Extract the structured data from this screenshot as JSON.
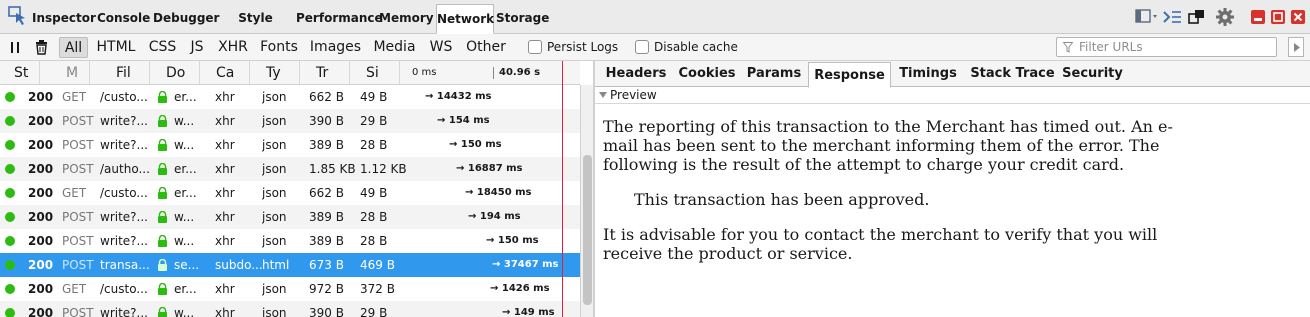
{
  "toolbox": {
    "tabs": [
      {
        "label": "Inspector"
      },
      {
        "label": "Console"
      },
      {
        "label": "Debugger"
      },
      {
        "label": "Style Editor"
      },
      {
        "label": "Performance"
      },
      {
        "label": "Memory"
      },
      {
        "label": "Network"
      },
      {
        "label": "Storage"
      }
    ],
    "selected_tab": "Network"
  },
  "filterbar": {
    "types": [
      "All",
      "HTML",
      "CSS",
      "JS",
      "XHR",
      "Fonts",
      "Images",
      "Media",
      "WS",
      "Other"
    ],
    "selected_type": "All",
    "persist_logs": "Persist Logs",
    "disable_cache": "Disable cache",
    "filter_placeholder": "Filter URLs"
  },
  "list": {
    "headers": {
      "status": "St",
      "method": "M",
      "file": "Fil",
      "domain": "Do",
      "cause": "Ca",
      "type": "Ty",
      "transferred": "Tr",
      "size": "Si",
      "waterfall_start": "0 ms",
      "waterfall_mark": "40.96 s"
    },
    "rows": [
      {
        "status": "200",
        "method": "GET",
        "file": "/custo...",
        "domain": "er...",
        "cause": "xhr",
        "type": "json",
        "transferred": "662 B",
        "size": "49 B",
        "timing": "→ 14432 ms"
      },
      {
        "status": "200",
        "method": "POST",
        "file": "write?...",
        "domain": "w...",
        "cause": "xhr",
        "type": "json",
        "transferred": "390 B",
        "size": "29 B",
        "timing": "→ 154 ms"
      },
      {
        "status": "200",
        "method": "POST",
        "file": "write?...",
        "domain": "w...",
        "cause": "xhr",
        "type": "json",
        "transferred": "389 B",
        "size": "28 B",
        "timing": "→ 150 ms"
      },
      {
        "status": "200",
        "method": "POST",
        "file": "/autho...",
        "domain": "er...",
        "cause": "xhr",
        "type": "json",
        "transferred": "1.85 KB",
        "size": "1.12 KB",
        "timing": "→ 16887 ms"
      },
      {
        "status": "200",
        "method": "GET",
        "file": "/custo...",
        "domain": "er...",
        "cause": "xhr",
        "type": "json",
        "transferred": "662 B",
        "size": "49 B",
        "timing": "→ 18450 ms"
      },
      {
        "status": "200",
        "method": "POST",
        "file": "write?...",
        "domain": "w...",
        "cause": "xhr",
        "type": "json",
        "transferred": "389 B",
        "size": "28 B",
        "timing": "→ 194 ms"
      },
      {
        "status": "200",
        "method": "POST",
        "file": "write?...",
        "domain": "w...",
        "cause": "xhr",
        "type": "json",
        "transferred": "389 B",
        "size": "28 B",
        "timing": "→ 150 ms"
      },
      {
        "status": "200",
        "method": "POST",
        "file": "transa...",
        "domain": "se...",
        "cause": "subdo...",
        "type": "html",
        "transferred": "673 B",
        "size": "469 B",
        "timing": "→ 37467 ms"
      },
      {
        "status": "200",
        "method": "GET",
        "file": "/custo...",
        "domain": "er...",
        "cause": "xhr",
        "type": "json",
        "transferred": "972 B",
        "size": "372 B",
        "timing": "→ 1426 ms"
      },
      {
        "status": "200",
        "method": "POST",
        "file": "write?...",
        "domain": "w...",
        "cause": "xhr",
        "type": "json",
        "transferred": "390 B",
        "size": "29 B",
        "timing": "→ 149 ms"
      }
    ]
  },
  "details": {
    "tabs": [
      {
        "label": "Headers"
      },
      {
        "label": "Cookies"
      },
      {
        "label": "Params"
      },
      {
        "label": "Response"
      },
      {
        "label": "Timings"
      },
      {
        "label": "Stack Trace"
      },
      {
        "label": "Security"
      }
    ],
    "selected_tab": "Response",
    "preview_label": "Preview",
    "response": {
      "p1": "The reporting of this transaction to the Merchant has timed out. An e-mail has been sent to the merchant informing them of the error. The following is the result of the attempt to charge your credit card.",
      "p2": "This transaction has been approved.",
      "p3": "It is advisable for you to contact the merchant to verify that you will receive the product or service."
    }
  },
  "colors": {
    "selected_row": "#3199ed",
    "status_ok": "#2cbb0f",
    "timeline_marker": "#e0213b",
    "window_close": "#d7322b"
  }
}
